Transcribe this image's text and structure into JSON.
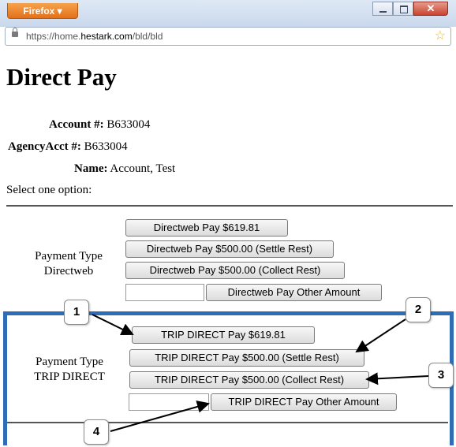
{
  "browser": {
    "menu_button": "Firefox ▾",
    "url_prefix": "https://home.",
    "url_domain": "hestark.com",
    "url_path": "/bld/bld",
    "close_glyph": "✕",
    "bookmark_glyph": "☆"
  },
  "page": {
    "title": "Direct Pay",
    "account_label": "Account #:",
    "account_value": " B633004",
    "agency_label": "AgencyAcct #:",
    "agency_value": " B633004",
    "name_label": "Name:",
    "name_value": " Account, Test",
    "select_prompt": "Select one option:"
  },
  "directweb": {
    "type_line1": "Payment Type",
    "type_line2": "Directweb",
    "buttons": [
      "Directweb Pay $619.81",
      "Directweb Pay $500.00 (Settle Rest)",
      "Directweb Pay $500.00 (Collect Rest)",
      "Directweb Pay Other Amount"
    ],
    "other_amount_value": ""
  },
  "tripdirect": {
    "type_line1": "Payment Type",
    "type_line2": "TRIP DIRECT",
    "buttons": [
      "TRIP DIRECT Pay $619.81",
      "TRIP DIRECT Pay $500.00 (Settle Rest)",
      "TRIP DIRECT Pay $500.00 (Collect Rest)",
      "TRIP DIRECT Pay Other Amount"
    ],
    "other_amount_value": ""
  },
  "callouts": [
    "1",
    "2",
    "3",
    "4"
  ],
  "colors": {
    "frame_accent": "#2e6db6",
    "firefox_button": "#e2701c"
  }
}
